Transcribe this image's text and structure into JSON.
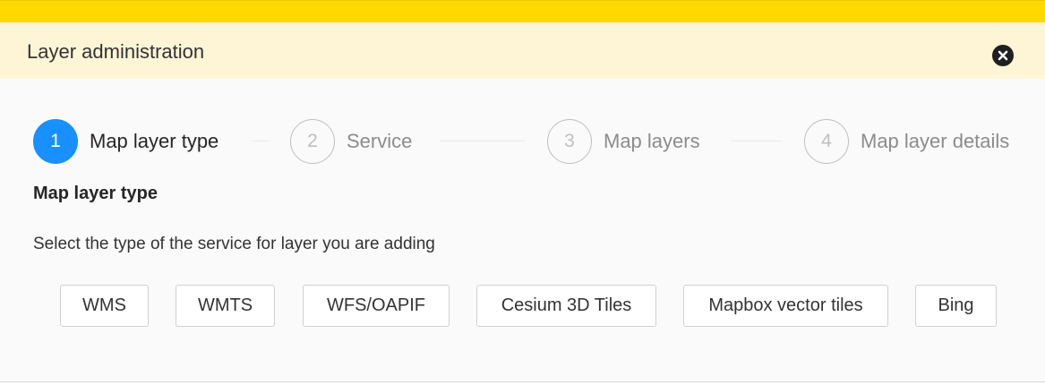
{
  "dialog": {
    "title": "Layer administration",
    "close_icon": "close-circle-icon"
  },
  "steps": [
    {
      "number": "1",
      "label": "Map layer type",
      "state": "active"
    },
    {
      "number": "2",
      "label": "Service",
      "state": "inactive"
    },
    {
      "number": "3",
      "label": "Map layers",
      "state": "inactive"
    },
    {
      "number": "4",
      "label": "Map layer details",
      "state": "inactive"
    }
  ],
  "content": {
    "heading": "Map layer type",
    "description": "Select the type of the service for layer you are adding",
    "options": [
      "WMS",
      "WMTS",
      "WFS/OAPIF",
      "Cesium 3D Tiles",
      "Mapbox vector tiles",
      "Bing"
    ]
  },
  "colors": {
    "top_bar": "#ffd800",
    "header_bg": "#fdf5d6",
    "active_step": "#1890ff"
  }
}
